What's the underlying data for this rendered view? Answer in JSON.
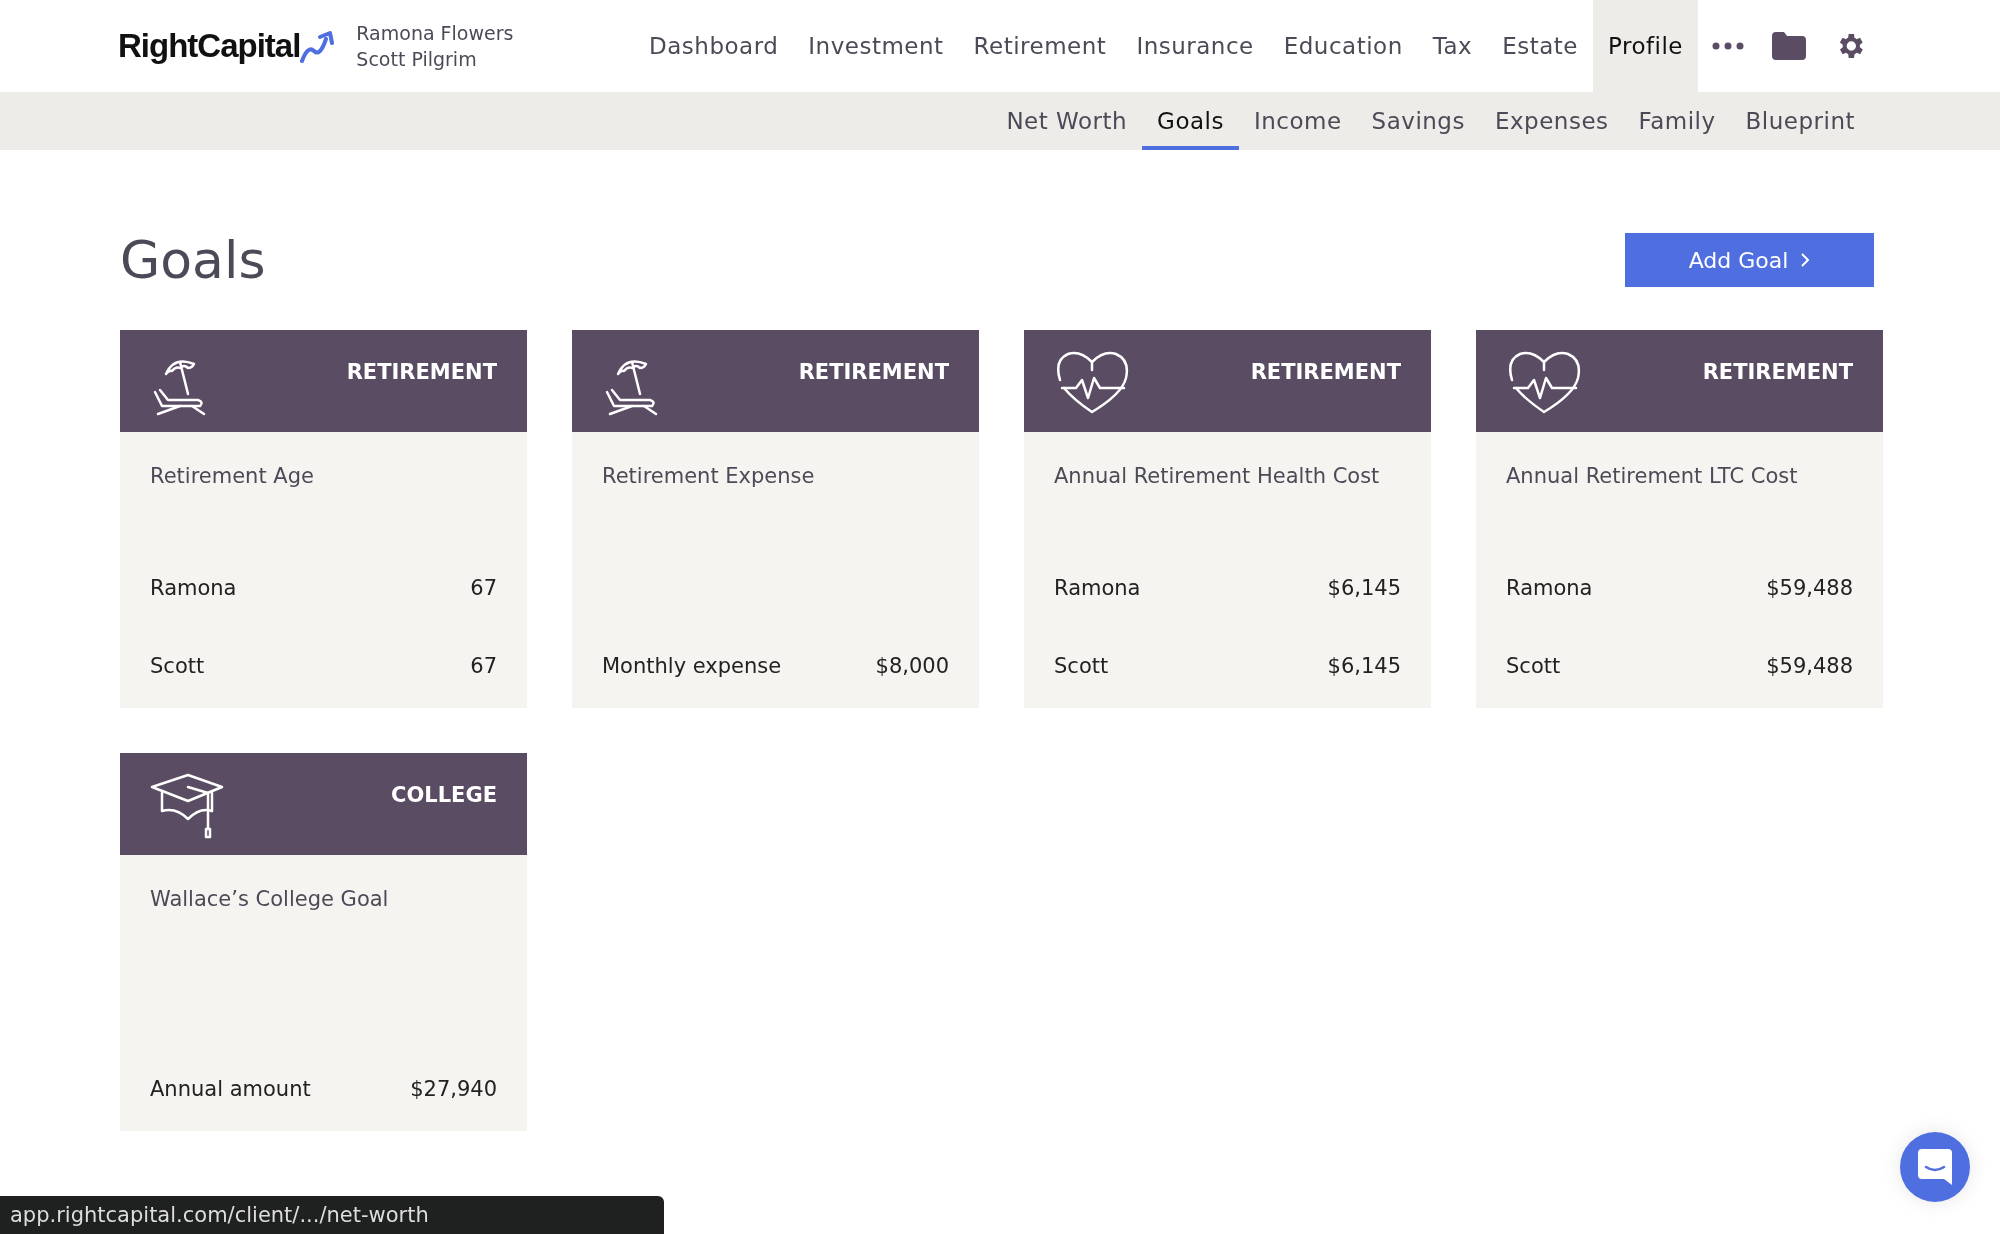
{
  "brand": {
    "name": "RightCapital"
  },
  "clients": [
    "Ramona Flowers",
    "Scott Pilgrim"
  ],
  "main_nav": [
    {
      "label": "Dashboard",
      "selected": false
    },
    {
      "label": "Investment",
      "selected": false
    },
    {
      "label": "Retirement",
      "selected": false
    },
    {
      "label": "Insurance",
      "selected": false
    },
    {
      "label": "Education",
      "selected": false
    },
    {
      "label": "Tax",
      "selected": false
    },
    {
      "label": "Estate",
      "selected": false
    },
    {
      "label": "Profile",
      "selected": true
    }
  ],
  "sub_nav": [
    {
      "label": "Net Worth",
      "selected": false
    },
    {
      "label": "Goals",
      "selected": true
    },
    {
      "label": "Income",
      "selected": false
    },
    {
      "label": "Savings",
      "selected": false
    },
    {
      "label": "Expenses",
      "selected": false
    },
    {
      "label": "Family",
      "selected": false
    },
    {
      "label": "Blueprint",
      "selected": false
    }
  ],
  "page_title": "Goals",
  "add_button": "Add Goal",
  "goals": [
    {
      "kind": "beach",
      "category": "RETIREMENT",
      "title": "Retirement Age",
      "rows": [
        {
          "label": "Ramona",
          "value": "67"
        },
        {
          "label": "Scott",
          "value": "67"
        }
      ]
    },
    {
      "kind": "beach",
      "category": "RETIREMENT",
      "title": "Retirement Expense",
      "rows": [
        {
          "label": "Monthly expense",
          "value": "$8,000"
        }
      ]
    },
    {
      "kind": "heart",
      "category": "RETIREMENT",
      "title": "Annual Retirement Health Cost",
      "rows": [
        {
          "label": "Ramona",
          "value": "$6,145"
        },
        {
          "label": "Scott",
          "value": "$6,145"
        }
      ]
    },
    {
      "kind": "heart",
      "category": "RETIREMENT",
      "title": "Annual Retirement LTC Cost",
      "rows": [
        {
          "label": "Ramona",
          "value": "$59,488"
        },
        {
          "label": "Scott",
          "value": "$59,488"
        }
      ]
    },
    {
      "kind": "cap",
      "category": "COLLEGE",
      "title": "Wallace’s College Goal",
      "rows": [
        {
          "label": "Annual amount",
          "value": "$27,940"
        }
      ]
    }
  ],
  "status_bar": {
    "url": "app.rightcapital.com/client/.../net-worth"
  }
}
